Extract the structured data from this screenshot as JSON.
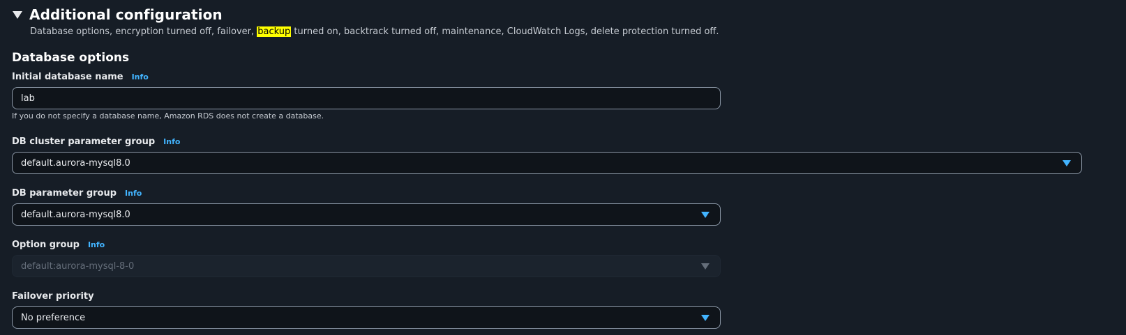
{
  "panel": {
    "title": "Additional configuration",
    "desc_before": "Database options, encryption turned off, failover, ",
    "desc_highlight": "backup",
    "desc_after": " turned on, backtrack turned off, maintenance, CloudWatch Logs, delete protection turned off."
  },
  "section": {
    "title": "Database options"
  },
  "fields": {
    "initial_db": {
      "label": "Initial database name",
      "info": "Info",
      "value": "lab",
      "hint": "If you do not specify a database name, Amazon RDS does not create a database."
    },
    "cluster_param_group": {
      "label": "DB cluster parameter group",
      "info": "Info",
      "value": "default.aurora-mysql8.0"
    },
    "db_param_group": {
      "label": "DB parameter group",
      "info": "Info",
      "value": "default.aurora-mysql8.0"
    },
    "option_group": {
      "label": "Option group",
      "info": "Info",
      "value": "default:aurora-mysql-8-0",
      "disabled": true
    },
    "failover_priority": {
      "label": "Failover priority",
      "value": "No preference"
    }
  },
  "colors": {
    "background": "#161d26",
    "accent": "#42b4ff",
    "highlight": "#ffff00"
  }
}
